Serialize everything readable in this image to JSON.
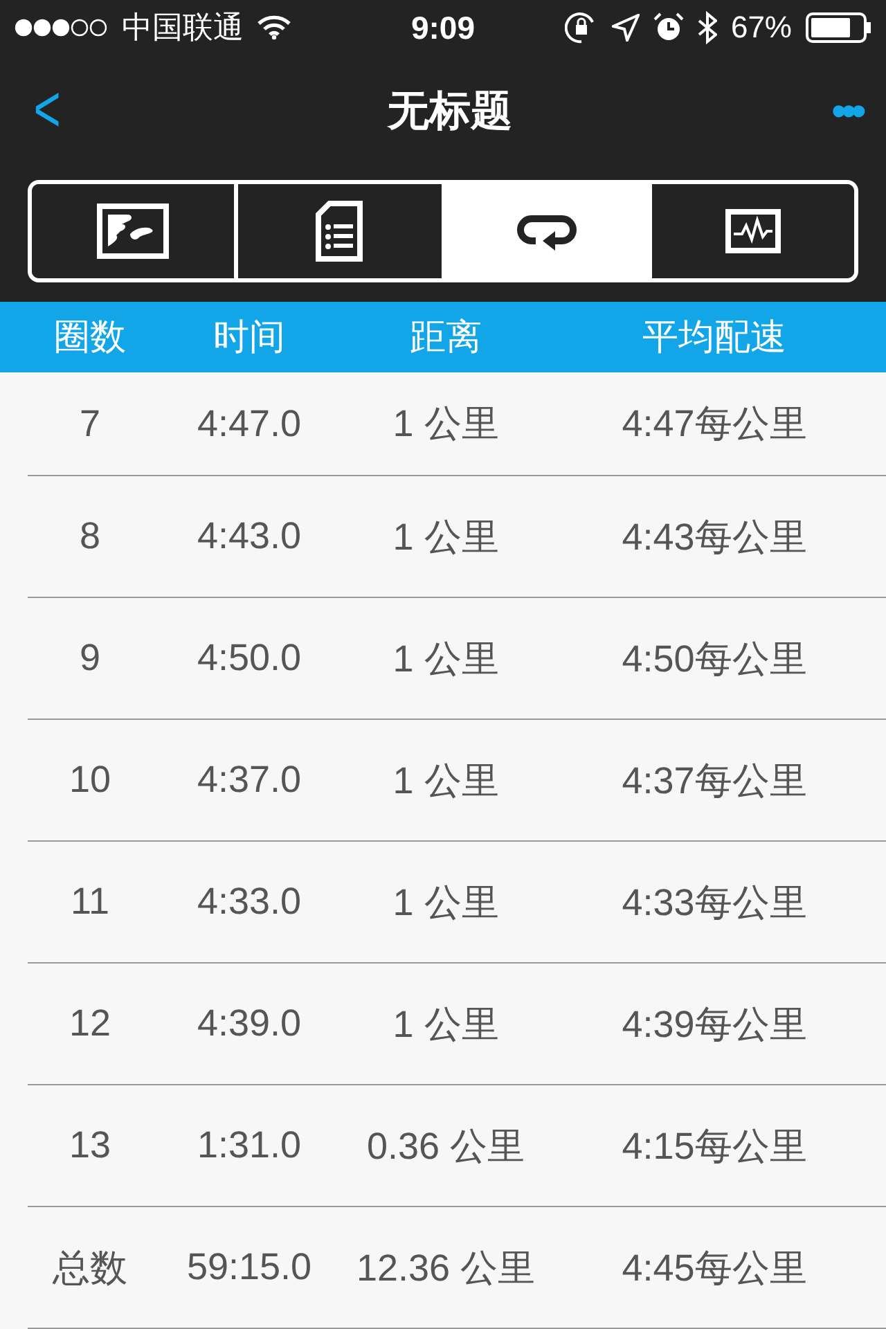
{
  "status_bar": {
    "carrier": "中国联通",
    "time": "9:09",
    "battery": "67%"
  },
  "nav": {
    "back": "<",
    "title": "无标题",
    "more": "•••"
  },
  "tabs": [
    {
      "kind": "map",
      "selected": false
    },
    {
      "kind": "summary",
      "selected": false
    },
    {
      "kind": "laps",
      "selected": true
    },
    {
      "kind": "chart",
      "selected": false
    }
  ],
  "table": {
    "columns": [
      "圈数",
      "时间",
      "距离",
      "平均配速"
    ],
    "rows": [
      [
        "7",
        "4:47.0",
        "1 公里",
        "4:47每公里"
      ],
      [
        "8",
        "4:43.0",
        "1 公里",
        "4:43每公里"
      ],
      [
        "9",
        "4:50.0",
        "1 公里",
        "4:50每公里"
      ],
      [
        "10",
        "4:37.0",
        "1 公里",
        "4:37每公里"
      ],
      [
        "11",
        "4:33.0",
        "1 公里",
        "4:33每公里"
      ],
      [
        "12",
        "4:39.0",
        "1 公里",
        "4:39每公里"
      ],
      [
        "13",
        "1:31.0",
        "0.36 公里",
        "4:15每公里"
      ],
      [
        "总数",
        "59:15.0",
        "12.36 公里",
        "4:45每公里"
      ]
    ]
  }
}
